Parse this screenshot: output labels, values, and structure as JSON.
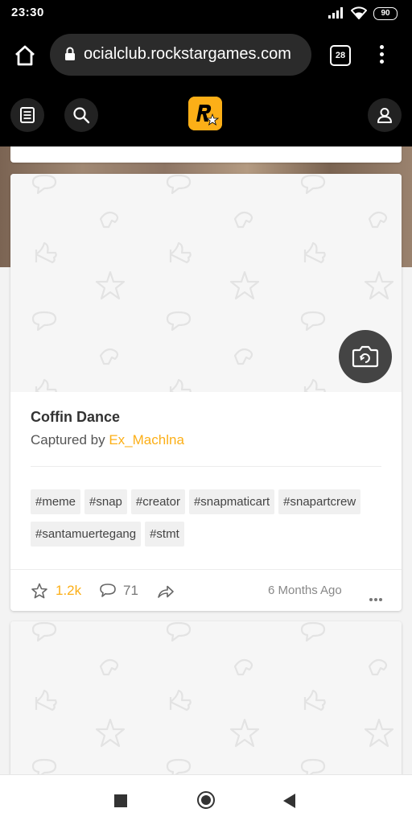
{
  "status": {
    "time": "23:30",
    "battery": "90"
  },
  "browser": {
    "url": "ocialclub.rockstargames.com",
    "tab_count": "28"
  },
  "header": {
    "logo_icon": "rockstar-logo"
  },
  "post": {
    "title": "Coffin Dance",
    "captured_label": "Captured by ",
    "author": "Ex_Machlna",
    "tags": [
      "#meme",
      "#snap",
      "#creator",
      "#snapmaticart",
      "#snapartcrew",
      "#santamuertegang",
      "#stmt"
    ],
    "likes": "1.2k",
    "comments": "71",
    "age": "6 Months Ago"
  },
  "colors": {
    "accent": "#fcaf17"
  }
}
